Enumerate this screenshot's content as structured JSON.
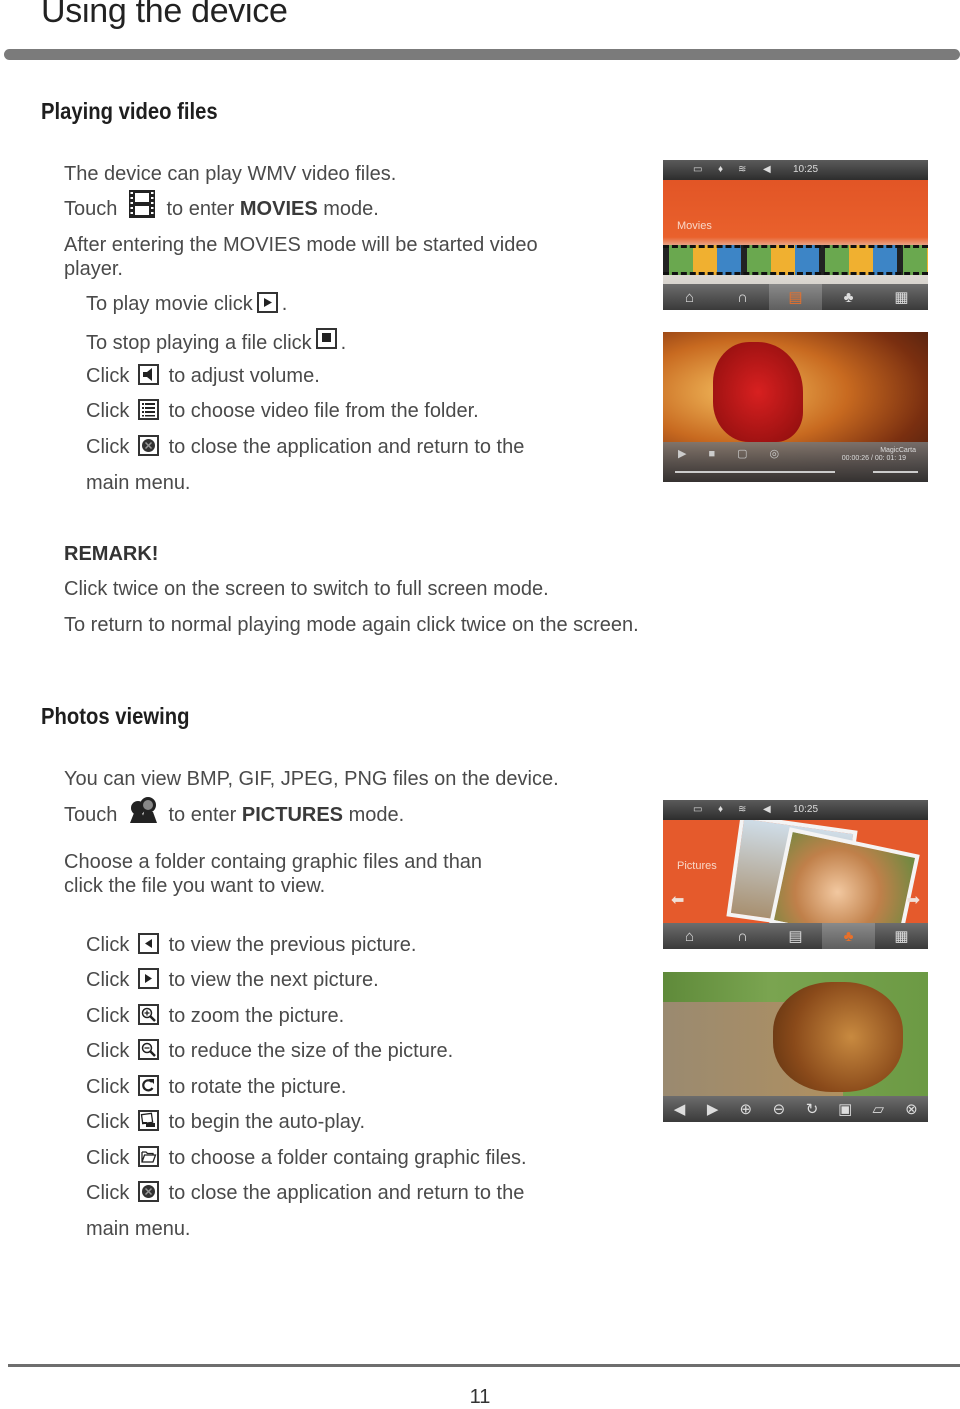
{
  "page_title": "Using the device",
  "page_number": "11",
  "video": {
    "heading": "Playing video files",
    "intro": "The device can play WMV video files.",
    "touch_prefix": "Touch",
    "touch_suffix_pre": "to enter",
    "touch_mode": "MOVIES",
    "touch_suffix_post": "mode.",
    "after_line1": "After entering the MOVIES mode will be started video",
    "after_line2": "player.",
    "play": {
      "text": "To play movie click",
      "end": "."
    },
    "stop": {
      "text": "To stop playing  a file click",
      "end": "."
    },
    "click_word": "Click",
    "actions": [
      {
        "icon": "volume-icon",
        "text": "to adjust volume."
      },
      {
        "icon": "list-icon",
        "text": "to choose video file from the folder."
      },
      {
        "icon": "close-icon",
        "text": "to close the application and return to the"
      }
    ],
    "close_cont": "main menu.",
    "remark_title": "REMARK!",
    "remark_lines": [
      "Click twice on the screen to switch to full screen mode.",
      "To return to normal playing mode again click twice on the screen."
    ],
    "screen_menu": {
      "time": "10:25",
      "label": "Movies"
    },
    "screen_player": {
      "title": "MagicCarta",
      "time": "00:00:26 / 00: 01: 19"
    }
  },
  "photos": {
    "heading": "Photos viewing",
    "intro": "You can view BMP, GIF, JPEG, PNG files on the device.",
    "touch_prefix": "Touch",
    "touch_suffix_pre": "to enter",
    "touch_mode": "PICTURES",
    "touch_suffix_post": "mode.",
    "choose_line1": "Choose a folder containg graphic files and than",
    "choose_line2": "click the file you want to view.",
    "click_word": "Click",
    "actions": [
      {
        "icon": "previous-icon",
        "text": "to view the previous picture."
      },
      {
        "icon": "next-icon",
        "text": "to view the next picture."
      },
      {
        "icon": "zoom-in-icon",
        "text": "to zoom the picture."
      },
      {
        "icon": "zoom-out-icon",
        "text": "to reduce the size of the picture."
      },
      {
        "icon": "rotate-icon",
        "text": "to rotate the picture."
      },
      {
        "icon": "slideshow-icon",
        "text": "to begin the auto-play."
      },
      {
        "icon": "folder-icon",
        "text": "to choose a folder containg graphic files."
      },
      {
        "icon": "close-icon",
        "text": "to close the application and return to the"
      }
    ],
    "close_cont": "main menu.",
    "screen_menu": {
      "time": "10:25",
      "label": "Pictures"
    }
  },
  "colors": {
    "accent_orange": "#e8552a",
    "rule_gray": "#7b7b7b"
  }
}
